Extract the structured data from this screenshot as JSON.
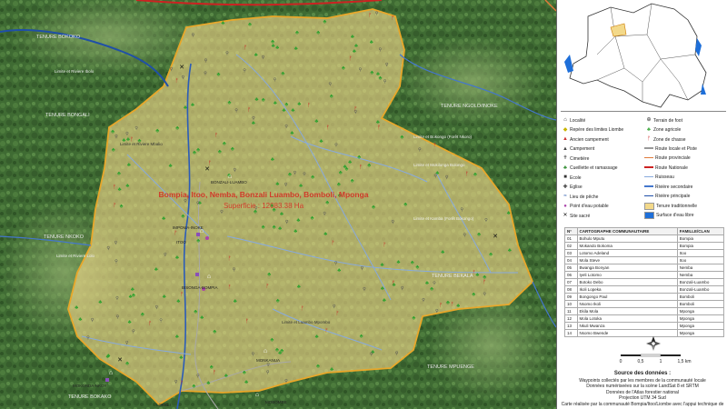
{
  "map": {
    "title": "Bompia, Itoo, Nemba, Bonzali Luambo, Bomboli, Mponga",
    "area": "Superficie : 12083.38 Ha",
    "area_labels": [
      {
        "text": "TENURE BONGALI"
      },
      {
        "text": "TENURE NGOLO/INOKE"
      },
      {
        "text": "TENURE NKOKO"
      },
      {
        "text": "TENURE BEKALA"
      },
      {
        "text": "TENURE MPUENGE"
      },
      {
        "text": "TENURE BOKAKO"
      },
      {
        "text": "TENURE BOKOKO"
      }
    ],
    "place_labels": [
      {
        "text": "BONZALI-LUAMBO"
      },
      {
        "text": "IMPOMA-INOKE"
      },
      {
        "text": "ITOO"
      },
      {
        "text": "BISONGA-BOMPIA"
      },
      {
        "text": "MONKANUA"
      },
      {
        "text": "MOKONDA-NKOY"
      },
      {
        "text": "MOBOMBE"
      },
      {
        "text": "LOBELI"
      }
    ],
    "limit_labels": [
      {
        "text": "Limite et Riviere Ibolo"
      },
      {
        "text": "Limite et Riviere Lolo"
      },
      {
        "text": "Limite et Riviere Mbalio"
      },
      {
        "text": "Limite et Bokongo (Forêt Nkoro)"
      },
      {
        "text": "Limite et Kamba (Forêt Bokongo)"
      },
      {
        "text": "Limite et Luambo Mpombo"
      },
      {
        "text": "Limite et Mokilonga Bolongo"
      }
    ]
  },
  "legend": {
    "left": [
      {
        "icon": "village-icon",
        "symbol": "⌂",
        "color": "#333333",
        "label": "Localité"
      },
      {
        "icon": "boundary-marker-icon",
        "symbol": "◆",
        "color": "#c8b400",
        "label": "Repère des limites Liombe"
      },
      {
        "icon": "old-camp-icon",
        "symbol": "▲",
        "color": "#cc3333",
        "label": "Ancien campement"
      },
      {
        "icon": "camp-icon",
        "symbol": "▲",
        "color": "#444444",
        "label": "Campement"
      },
      {
        "icon": "cemetery-icon",
        "symbol": "✝",
        "color": "#444444",
        "label": "Cimetière"
      },
      {
        "icon": "gathering-icon",
        "symbol": "♣",
        "color": "#2e8b2e",
        "label": "Cueillette et ramassage"
      },
      {
        "icon": "school-icon",
        "symbol": "■",
        "color": "#333333",
        "label": "Ecole"
      },
      {
        "icon": "church-icon",
        "symbol": "✚",
        "color": "#333333",
        "label": "Eglise"
      },
      {
        "icon": "fishing-icon",
        "symbol": "≈",
        "color": "#2255aa",
        "label": "Lieu de pêche"
      },
      {
        "icon": "water-point-icon",
        "symbol": "●",
        "color": "#aa44aa",
        "label": "Point d'eau potable"
      },
      {
        "icon": "sacred-site-icon",
        "symbol": "✕",
        "color": "#111111",
        "label": "Site sacré"
      }
    ],
    "right": [
      {
        "icon": "football-field-icon",
        "kind": "sym",
        "symbol": "⊕",
        "color": "#333333",
        "label": "Terrain de foot"
      },
      {
        "icon": "farm-zone-icon",
        "kind": "sym",
        "symbol": "♣",
        "color": "#3aa83a",
        "label": "Zone agricole"
      },
      {
        "icon": "hunting-zone-icon",
        "kind": "sym",
        "symbol": "ᚠ",
        "color": "#cc2222",
        "label": "Zone de chasse"
      },
      {
        "icon": "local-road-icon",
        "kind": "line",
        "color": "#999999",
        "label": "Route locale et Piste"
      },
      {
        "icon": "provincial-road-icon",
        "kind": "line",
        "color": "#e07a3a",
        "label": "Route provinciale"
      },
      {
        "icon": "national-road-icon",
        "kind": "line",
        "color": "#cc2222",
        "label": "Route Nationale"
      },
      {
        "icon": "stream-icon",
        "kind": "line",
        "color": "#88aadd",
        "label": "Ruisseau"
      },
      {
        "icon": "secondary-river-icon",
        "kind": "line",
        "color": "#4477cc",
        "label": "Rivière secondaire"
      },
      {
        "icon": "main-river-icon",
        "kind": "line",
        "color": "#1f4fa8",
        "label": "Rivière principale"
      },
      {
        "icon": "tenure-area-icon",
        "kind": "box",
        "color": "#f3d98a",
        "label": "Tenure traditionnelle"
      },
      {
        "icon": "water-surface-icon",
        "kind": "box",
        "color": "#1e6fd9",
        "label": "Surface d'eau libre"
      }
    ]
  },
  "table": {
    "headers": [
      "N°",
      "CARTOGRAPHE COMMUNAUTAIRE",
      "FAMILLE/CLAN"
    ],
    "rows": [
      [
        "01",
        "Bohulo Mputu",
        "Bompia"
      ],
      [
        "02",
        "Mokando Bokoma",
        "Bompia"
      ],
      [
        "03",
        "Lotomo Adeland",
        "Itoo"
      ],
      [
        "04",
        "Mola Steve",
        "Itoo"
      ],
      [
        "05",
        "Bwanga Bonyan",
        "Nemba"
      ],
      [
        "06",
        "Iyeli Lotomo",
        "Nemba"
      ],
      [
        "07",
        "Botoko Debo",
        "Bonzali-Luambo"
      ],
      [
        "08",
        "Ikoli Lopeka",
        "Bonzali-Luambo"
      ],
      [
        "09",
        "Bongongo Paul",
        "Bomboli"
      ],
      [
        "10",
        "Nsomo Ikoli",
        "Bomboli"
      ],
      [
        "11",
        "Ekila Mola",
        "Mponga"
      ],
      [
        "12",
        "Mola Lotoka",
        "Mponga"
      ],
      [
        "13",
        "Nkuli Mwanza",
        "Mponga"
      ],
      [
        "14",
        "Nsomo Bwende",
        "Mponga"
      ]
    ]
  },
  "scale": {
    "ticks": [
      "0",
      "0,5",
      "1",
      "1,5 km"
    ]
  },
  "sources": {
    "title": "Source des données :",
    "lines": [
      "Waypoints collectés par les membres de la communauté locale",
      "Données numériseées sur la scène LandSat 8 et SRTM",
      "Données de l'Atlas forestier national",
      "Projection UTM 34 Sud",
      "",
      "Carte réalisée par la communauté Bompia/Itoo/Liombe avec l'appui technique de"
    ]
  }
}
